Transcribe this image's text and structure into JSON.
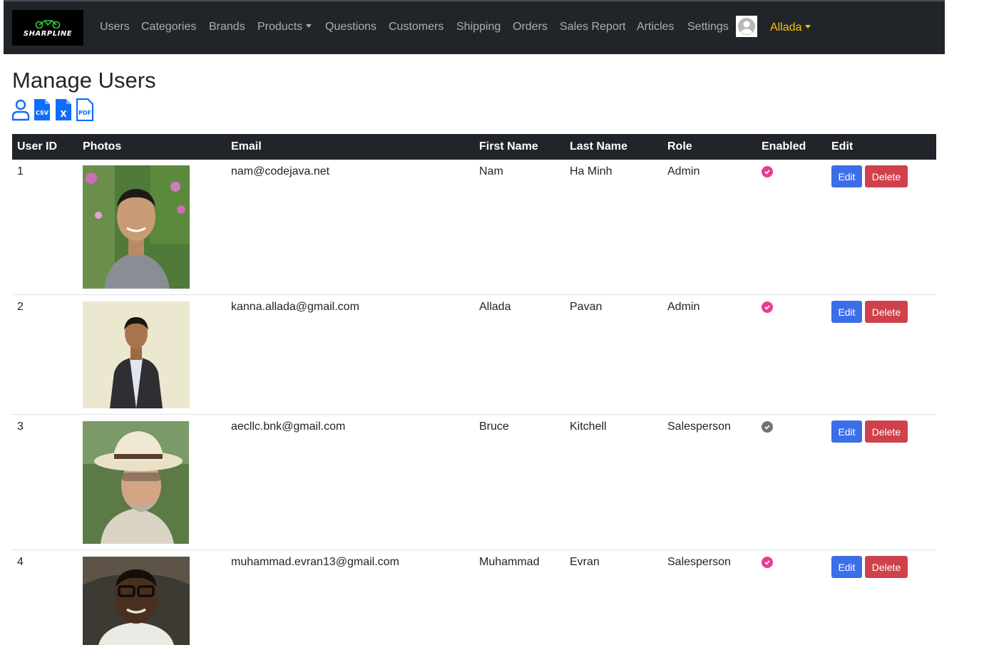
{
  "brand": {
    "logo_text": "SHARPLINE",
    "logo_color": "#2ecc40"
  },
  "nav": {
    "items": [
      "Users",
      "Categories",
      "Brands",
      "Products",
      "Questions",
      "Customers",
      "Shipping",
      "Orders",
      "Sales Report",
      "Articles",
      "Settings"
    ],
    "user_name": "Allada",
    "user_color": "#ffc107"
  },
  "page": {
    "title": "Manage Users"
  },
  "toolbar": {
    "icons": [
      "add-user-icon",
      "csv-export-icon",
      "excel-export-icon",
      "pdf-export-icon"
    ],
    "csv_label": "CSV",
    "excel_label": "X",
    "pdf_label": "PDF"
  },
  "table": {
    "headers": [
      "User ID",
      "Photos",
      "Email",
      "First Name",
      "Last Name",
      "Role",
      "Enabled",
      "Edit"
    ],
    "edit_label": "Edit",
    "delete_label": "Delete",
    "rows": [
      {
        "id": "1",
        "email": "nam@codejava.net",
        "first_name": "Nam",
        "last_name": "Ha Minh",
        "role": "Admin",
        "enabled": true
      },
      {
        "id": "2",
        "email": "kanna.allada@gmail.com",
        "first_name": "Allada",
        "last_name": "Pavan",
        "role": "Admin",
        "enabled": true
      },
      {
        "id": "3",
        "email": "aecllc.bnk@gmail.com",
        "first_name": "Bruce",
        "last_name": "Kitchell",
        "role": "Salesperson",
        "enabled": false
      },
      {
        "id": "4",
        "email": "muhammad.evran13@gmail.com",
        "first_name": "Muhammad",
        "last_name": "Evran",
        "role": "Salesperson",
        "enabled": true
      }
    ]
  },
  "colors": {
    "navbar": "#212529",
    "accent_blue": "#0d6efd",
    "edit_button": "#3b6ee8",
    "delete_button": "#d0414c",
    "enabled": "#e83e8c",
    "disabled": "#6c757d"
  }
}
